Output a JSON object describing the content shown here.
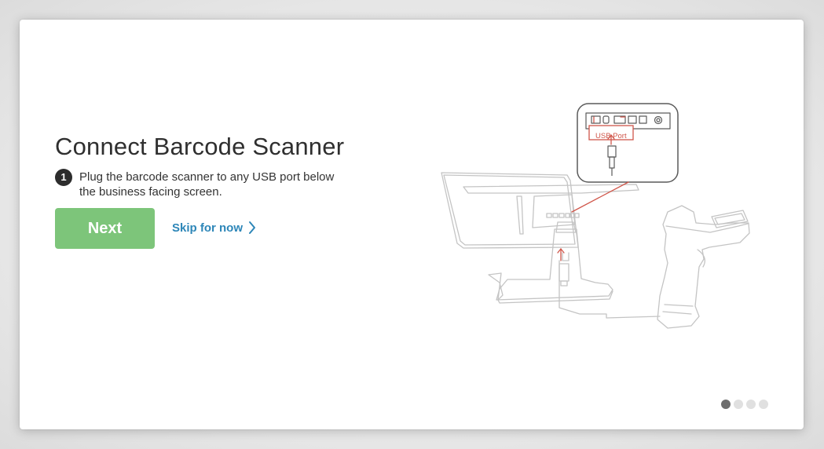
{
  "heading": "Connect Barcode Scanner",
  "step": {
    "number": "1",
    "text": "Plug the barcode scanner to any USB port below the business facing screen."
  },
  "actions": {
    "next_label": "Next",
    "skip_label": "Skip for now"
  },
  "illustration": {
    "port_label": "USB Port"
  },
  "pager": {
    "total": 4,
    "current": 1
  },
  "colors": {
    "primary_button": "#7dc57a",
    "link": "#2d86b8",
    "accent_red": "#d0564a",
    "dot_active": "#6e6e6e",
    "dot_inactive": "#e0e0e0"
  },
  "icons": {
    "skip_chevron": "chevron-right-icon"
  }
}
